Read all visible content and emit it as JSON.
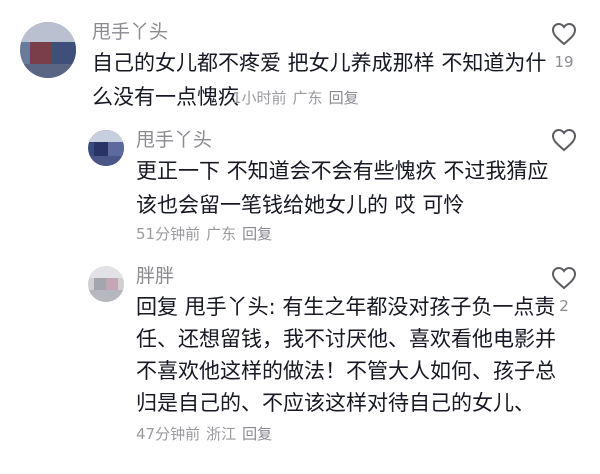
{
  "comments": [
    {
      "username": "甩手丫头",
      "lines": [
        "自己的女儿都不疼爱  把女儿养成那样  不知道为什",
        "么没有一点愧疚"
      ],
      "time": "1小时前",
      "location": "广东",
      "reply_label": "回复",
      "like_count": "19"
    },
    {
      "username": "甩手丫头",
      "lines": [
        "更正一下  不知道会不会有些愧疚  不过我猜应",
        "该也会留一笔钱给她女儿的  哎  可怜"
      ],
      "time": "51分钟前",
      "location": "广东",
      "reply_label": "回复",
      "like_count": ""
    },
    {
      "username": "胖胖",
      "lines": [
        "回复 甩手丫头: 有生之年都没对孩子负一点责",
        "任、还想留钱，我不讨厌他、喜欢看他电影并",
        "不喜欢他这样的做法！不管大人如何、孩子总",
        "归是自己的、不应该这样对待自己的女儿、"
      ],
      "time": "47分钟前",
      "location": "浙江",
      "reply_label": "回复",
      "like_count": "2"
    }
  ],
  "icons": {
    "like": "heart-outline-icon"
  },
  "colors": {
    "text": "#161823",
    "muted": "#8a8b91"
  }
}
